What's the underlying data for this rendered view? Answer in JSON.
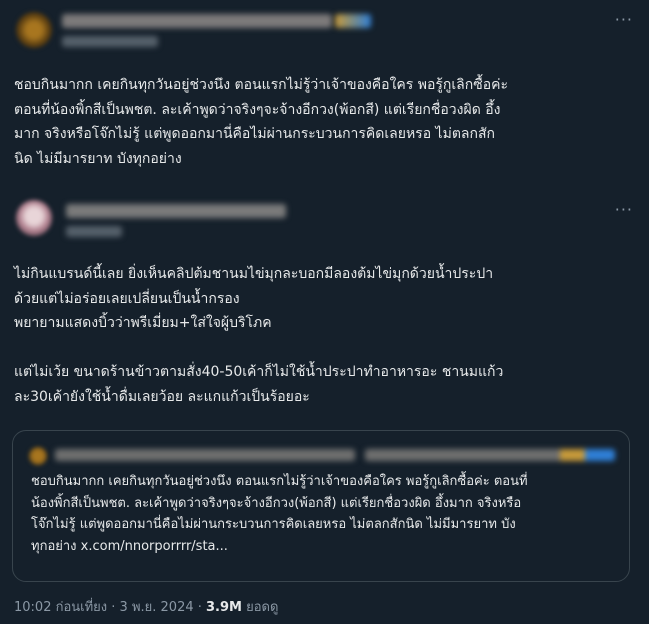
{
  "first_tweet": {
    "text": "ชอบกินมากก เคยกินทุกวันอยู่ช่วงนึง ตอนแรกไม่รู้ว่าเจ้าของคือใคร พอรู้กูเลิกซื้อค่ะ\nตอนที่น้องพิ้กสีเป็นพชต. ละเค้าพูดว่าจริงๆจะจ้างอีกวง(พ้อกสี) แต่เรียกชื่อวงผิด อึ้ง\nมาก จริงหรือโจ๊กไม่รู้ แต่พูดออกมานี่คือไม่ผ่านกระบวนการคิดเลยหรอ ไม่ตลกสัก\nนิด ไม่มีมารยาท บังทุกอย่าง"
  },
  "second_tweet": {
    "text": "ไม่กินแบรนด์นี้เลย ยิ่งเห็นคลิปต้มชานมไข่มุกละบอกมีลองต้มไข่มุกด้วยน้ำประปา\nด้วยแต่ไม่อร่อยเลยเปลี่ยนเป็นน้ำกรอง\nพยายามแสดงบิ้วว่าพรีเมี่ยม+ใส่ใจผู้บริโภค\n\nแต่ไม่เว้ย ขนาดร้านข้าวตามสั่ง40-50เค้าก็ไม่ใช้น้ำประปาทำอาหารอะ ชานมแก้ว\nละ30เค้ายังใช้น้ำดื่มเลยว้อย ละแกแก้วเป็นร้อยอะ",
    "quote_text": "ชอบกินมากก เคยกินทุกวันอยู่ช่วงนึง ตอนแรกไม่รู้ว่าเจ้าของคือใคร พอรู้กูเลิกซื้อค่ะ ตอนที่\nน้องพิ้กสีเป็นพชต. ละเค้าพูดว่าจริงๆจะจ้างอีกวง(พ้อกสี) แต่เรียกชื่อวงผิด อึ้งมาก จริงหรือ\nโจ๊กไม่รู้ แต่พูดออกมานี่คือไม่ผ่านกระบวนการคิดเลยหรอ ไม่ตลกสักนิด ไม่มีมารยาท บัง\nทุกอย่าง x.com/nnorporrrr/sta...",
    "time": "10:02 ก่อนเที่ยง · 3 พ.ย. 2024 · ",
    "views_count": "3.9M",
    "views_label": " ยอดดู"
  },
  "icons": {
    "more": "more-horizontal-icon"
  },
  "colors": {
    "background": "#15202b",
    "text": "#e7e9ea",
    "muted": "#8b98a5",
    "border": "#38444d"
  }
}
